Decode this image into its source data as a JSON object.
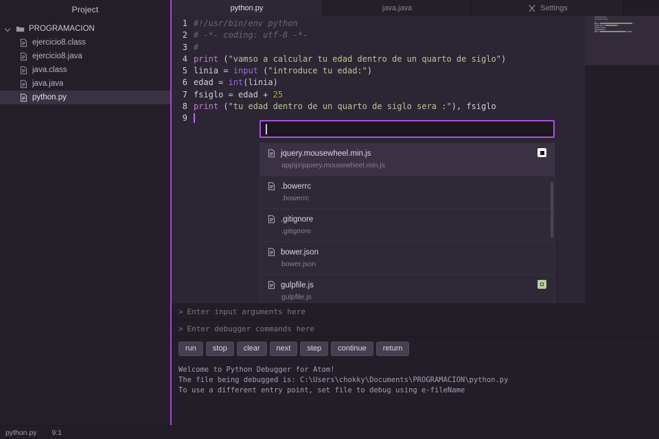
{
  "colors": {
    "accent": "#a349d4",
    "accent_bright": "#b14ee8",
    "bg_window": "#1f1a23",
    "bg_sidebar": "#241e29",
    "bg_editor": "#2c2533",
    "bg_panel": "#231d28",
    "badge_green": "#b9cea0"
  },
  "sidebar": {
    "title": "Project",
    "root": {
      "label": "PROGRAMACION",
      "icon": "folder-icon",
      "chevron": "chevron-down-icon",
      "expanded": true
    },
    "items": [
      {
        "label": "ejercicio8.class",
        "icon": "file-icon",
        "selected": false
      },
      {
        "label": "ejercicio8.java",
        "icon": "file-icon",
        "selected": false
      },
      {
        "label": "java.class",
        "icon": "file-icon",
        "selected": false
      },
      {
        "label": "java.java",
        "icon": "file-icon",
        "selected": false
      },
      {
        "label": "python.py",
        "icon": "file-icon",
        "selected": true
      }
    ]
  },
  "tabs": [
    {
      "label": "python.py",
      "icon": null,
      "active": true
    },
    {
      "label": "java.java",
      "icon": null,
      "active": false
    },
    {
      "label": "Settings",
      "icon": "tools-icon",
      "active": false
    }
  ],
  "editor": {
    "lines": [
      {
        "n": "1",
        "tokens": [
          {
            "t": "#!/usr/bin/env python",
            "c": "c-com"
          }
        ]
      },
      {
        "n": "2",
        "tokens": [
          {
            "t": "# -*- coding: utf-8 -*-",
            "c": "c-com"
          }
        ]
      },
      {
        "n": "3",
        "tokens": [
          {
            "t": "#",
            "c": "c-com"
          }
        ]
      },
      {
        "n": "4",
        "tokens": [
          {
            "t": "print",
            "c": "c-kw"
          },
          {
            "t": " (",
            "c": "c-pl"
          },
          {
            "t": "\"vamso a calcular tu edad dentro de un quarto de siglo\"",
            "c": "c-str"
          },
          {
            "t": ")",
            "c": "c-pl"
          }
        ]
      },
      {
        "n": "5",
        "tokens": [
          {
            "t": "linia = ",
            "c": "c-pl"
          },
          {
            "t": "input",
            "c": "c-fn"
          },
          {
            "t": " (",
            "c": "c-pl"
          },
          {
            "t": "\"introduce tu edad:\"",
            "c": "c-str"
          },
          {
            "t": ")",
            "c": "c-pl"
          }
        ]
      },
      {
        "n": "6",
        "tokens": [
          {
            "t": "edad = ",
            "c": "c-pl"
          },
          {
            "t": "int",
            "c": "c-fn"
          },
          {
            "t": "(linia)",
            "c": "c-pl"
          }
        ]
      },
      {
        "n": "7",
        "tokens": [
          {
            "t": "fsiglo = edad + ",
            "c": "c-pl"
          },
          {
            "t": "25",
            "c": "c-num"
          }
        ]
      },
      {
        "n": "8",
        "tokens": [
          {
            "t": "print",
            "c": "c-kw"
          },
          {
            "t": " (",
            "c": "c-pl"
          },
          {
            "t": "\"tu edad dentro de un quarto de siglo sera :\"",
            "c": "c-str"
          },
          {
            "t": "), fsiglo",
            "c": "c-pl"
          }
        ]
      },
      {
        "n": "9",
        "tokens": [],
        "caret": true
      }
    ]
  },
  "finder": {
    "input_value": "",
    "input_placeholder": "",
    "results": [
      {
        "name": "jquery.mousewheel.min.js",
        "path": "app\\js\\jquery.mousewheel.min.js",
        "icon": "file-icon",
        "selected": true,
        "badge": "white"
      },
      {
        "name": ".bowerrc",
        "path": ".bowerrc",
        "icon": "file-icon",
        "selected": false,
        "badge": null
      },
      {
        "name": ".gitignore",
        "path": ".gitignore",
        "icon": "file-icon",
        "selected": false,
        "badge": null
      },
      {
        "name": "bower.json",
        "path": "bower.json",
        "icon": "file-icon",
        "selected": false,
        "badge": null
      },
      {
        "name": "gulpfile.js",
        "path": "gulpfile.js",
        "icon": "file-icon",
        "selected": false,
        "badge": "green"
      }
    ]
  },
  "debug_panel": {
    "input_args_placeholder": "Enter input arguments here",
    "debugger_cmd_placeholder": "Enter debugger commands here",
    "prompt": ">",
    "buttons": [
      "run",
      "stop",
      "clear",
      "next",
      "step",
      "continue",
      "return"
    ],
    "console": "Welcome to Python Debugger for Atom!\nThe file being debugged is: C:\\Users\\chokky\\Documents\\PROGRAMACION\\python.py\nTo use a different entry point, set file to debug using e-fileName"
  },
  "statusbar": {
    "filename": "python.py",
    "cursor": "9:1"
  }
}
